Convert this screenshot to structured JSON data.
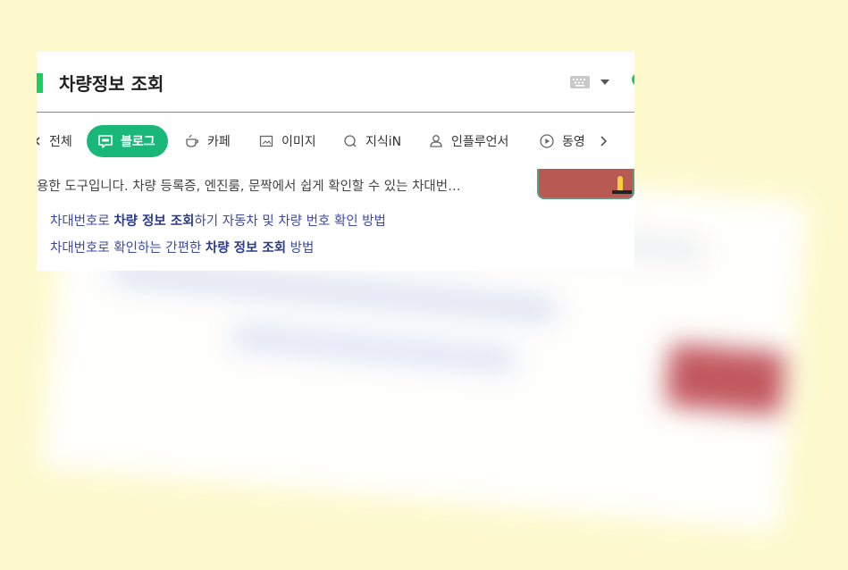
{
  "search": {
    "query": "차량정보 조회"
  },
  "tabs": [
    {
      "label": "전체",
      "icon": "all-icon"
    },
    {
      "label": "블로그",
      "icon": "blog-icon"
    },
    {
      "label": "카페",
      "icon": "cafe-icon"
    },
    {
      "label": "이미지",
      "icon": "image-icon"
    },
    {
      "label": "지식iN",
      "icon": "knowledge-icon"
    },
    {
      "label": "인플루언서",
      "icon": "person-icon"
    },
    {
      "label": "동영",
      "icon": "play-icon"
    }
  ],
  "result": {
    "snippet": "용한 도구입니다. 차량 등록증, 엔진룸, 문짝에서 쉽게 확인할 수 있는 차대번…",
    "links": [
      {
        "pre": "차대번호로 ",
        "bold": "차량 정보 조회",
        "post": "하기 자동차 및 차량 번호 확인 방법"
      },
      {
        "pre": "차대번호로 확인하는 간편한 ",
        "bold": "차량 정보 조회",
        "post": " 방법"
      }
    ]
  },
  "colors": {
    "background": "#fdf9cd",
    "accent": "#19b878",
    "link": "#3c4aa0"
  }
}
